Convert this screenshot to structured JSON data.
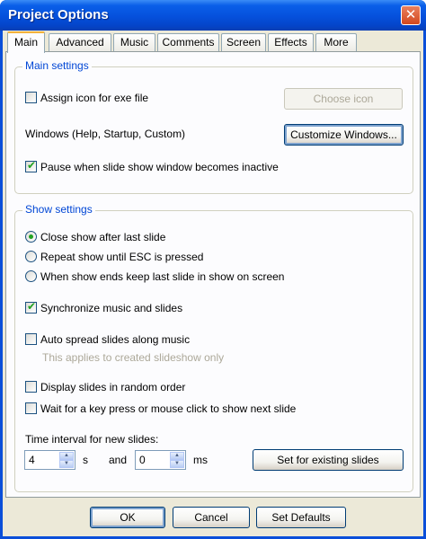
{
  "window": {
    "title": "Project Options",
    "close_glyph": "✕"
  },
  "tabs": [
    {
      "label": "Main",
      "active": true
    },
    {
      "label": "Advanced",
      "active": false
    },
    {
      "label": "Music",
      "active": false
    },
    {
      "label": "Comments",
      "active": false
    },
    {
      "label": "Screen",
      "active": false
    },
    {
      "label": "Effects",
      "active": false
    },
    {
      "label": "More",
      "active": false
    }
  ],
  "main_settings": {
    "title": "Main settings",
    "assign_icon": {
      "label": "Assign icon for exe file",
      "checked": false
    },
    "choose_icon_button": "Choose icon",
    "windows_label": "Windows (Help, Startup, Custom)",
    "customize_windows_button": "Customize Windows...",
    "pause": {
      "label": "Pause when slide show window becomes inactive",
      "checked": true
    }
  },
  "show_settings": {
    "title": "Show settings",
    "radios": [
      {
        "label": "Close show after last slide",
        "selected": true
      },
      {
        "label": "Repeat show until ESC is pressed",
        "selected": false
      },
      {
        "label": "When show ends keep last slide in show on screen",
        "selected": false
      }
    ],
    "sync_music": {
      "label": "Synchronize music and slides",
      "checked": true
    },
    "auto_spread": {
      "label": "Auto spread slides along music",
      "checked": false
    },
    "auto_spread_hint": "This applies to created slideshow only",
    "random_order": {
      "label": "Display slides in random order",
      "checked": false
    },
    "wait_key": {
      "label": "Wait for a key press or mouse click to show next slide",
      "checked": false
    },
    "interval_label": "Time interval for new slides:",
    "seconds_value": "4",
    "seconds_unit": "s",
    "and_label": "and",
    "ms_value": "0",
    "ms_unit": "ms",
    "set_existing_button": "Set for existing slides"
  },
  "footer": {
    "ok": "OK",
    "cancel": "Cancel",
    "set_defaults": "Set Defaults"
  },
  "colors": {
    "titlebar": "#0550dc",
    "dialog_bg": "#ece9d8",
    "group_title": "#0046d5",
    "check_mark": "#21a121"
  }
}
